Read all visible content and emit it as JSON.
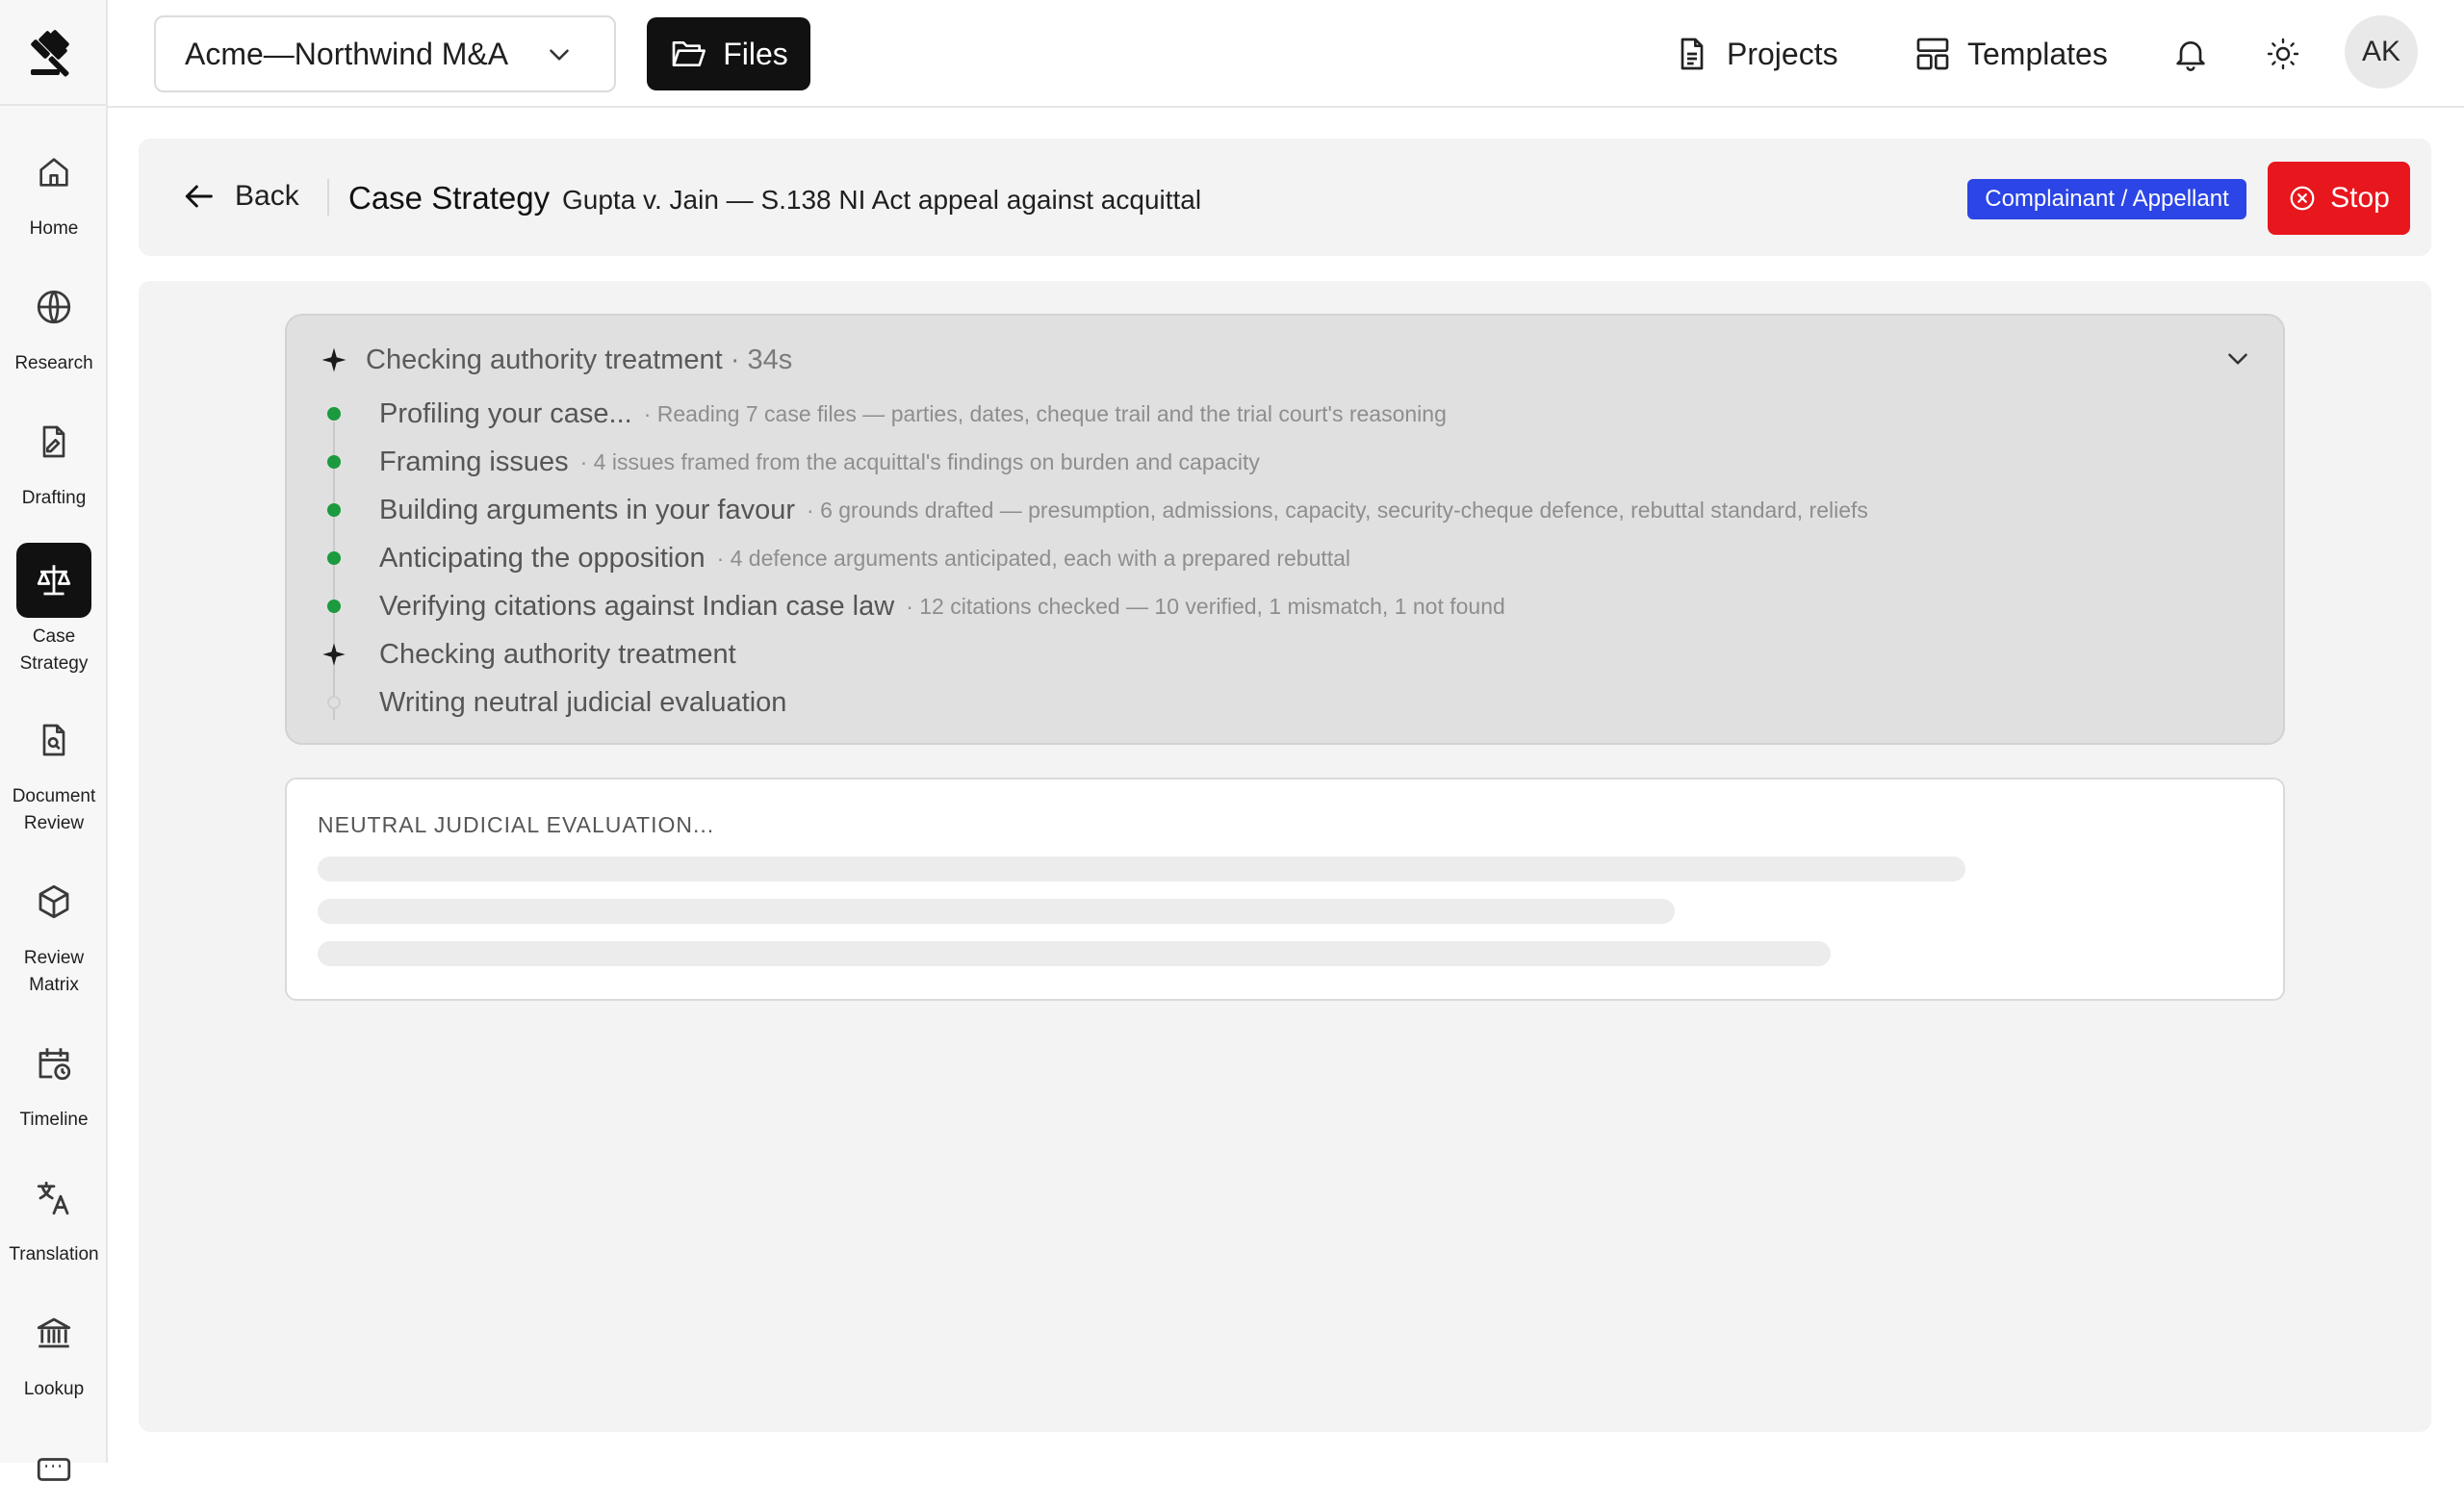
{
  "sidebar": {
    "items": [
      {
        "label": "Home",
        "icon": "home-icon"
      },
      {
        "label": "Research",
        "icon": "globe-icon"
      },
      {
        "label": "Drafting",
        "icon": "document-edit-icon"
      },
      {
        "label": "Case Strategy",
        "icon": "scales-icon",
        "active": true
      },
      {
        "label": "Document Review",
        "icon": "document-search-icon"
      },
      {
        "label": "Review Matrix",
        "icon": "cube-icon"
      },
      {
        "label": "Timeline",
        "icon": "calendar-clock-icon"
      },
      {
        "label": "Translation",
        "icon": "translate-icon"
      },
      {
        "label": "Lookup",
        "icon": "bank-icon"
      }
    ]
  },
  "topbar": {
    "workspace": "Acme—Northwind M&A",
    "files_label": "Files",
    "projects_label": "Projects",
    "templates_label": "Templates",
    "avatar_initials": "AK"
  },
  "header": {
    "back_label": "Back",
    "title": "Case Strategy",
    "case_name": "Gupta v. Jain — S.138 NI Act appeal against acquittal",
    "role_badge": "Complainant / Appellant",
    "stop_label": "Stop"
  },
  "progress": {
    "current_label": "Checking authority treatment",
    "elapsed": "· 34s",
    "steps": [
      {
        "title": "Profiling your case...",
        "detail": "· Reading 7 case files — parties, dates, cheque trail and the trial court's reasoning",
        "status": "done"
      },
      {
        "title": "Framing issues",
        "detail": "· 4 issues framed from the acquittal's findings on burden and capacity",
        "status": "done"
      },
      {
        "title": "Building arguments in your favour",
        "detail": "· 6 grounds drafted — presumption, admissions, capacity, security-cheque defence, rebuttal standard, reliefs",
        "status": "done"
      },
      {
        "title": "Anticipating the opposition",
        "detail": "· 4 defence arguments anticipated, each with a prepared rebuttal",
        "status": "done"
      },
      {
        "title": "Verifying citations against Indian case law",
        "detail": "· 12 citations checked — 10 verified, 1 mismatch, 1 not found",
        "status": "done"
      },
      {
        "title": "Checking authority treatment",
        "detail": "",
        "status": "in-progress"
      },
      {
        "title": "Writing neutral judicial evaluation",
        "detail": "",
        "status": "pending"
      }
    ]
  },
  "evaluation": {
    "title": "NEUTRAL JUDICIAL EVALUATION..."
  },
  "colors": {
    "accent_dark": "#111111",
    "badge_blue": "#2b45e6",
    "stop_red": "#e8161d",
    "done_green": "#1b9a3e"
  }
}
